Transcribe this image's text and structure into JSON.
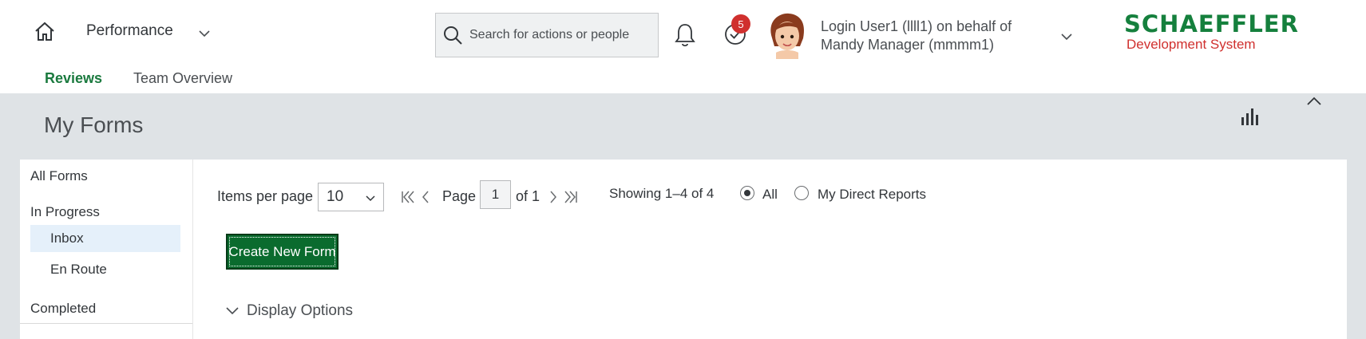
{
  "header": {
    "module": "Performance",
    "search_placeholder": "Search for actions or people",
    "todo_count": "5",
    "user_name": "Login User1 (llll1) on behalf of Mandy Manager (mmmm1)",
    "logo": {
      "line1": "SCHAEFFLER",
      "line2": "Development System"
    },
    "icons": [
      "home-icon",
      "chevron-down-icon",
      "search-icon",
      "bell-icon",
      "todo-check-icon",
      "avatar",
      "chart-icon",
      "collapse-icon"
    ]
  },
  "subnav": {
    "tabs": [
      {
        "label": "Reviews",
        "active": true
      },
      {
        "label": "Team Overview",
        "active": false
      }
    ]
  },
  "page": {
    "title": "My Forms"
  },
  "sidebar": {
    "items": [
      {
        "label": "All Forms"
      },
      {
        "label": "In Progress"
      },
      {
        "label": "Inbox",
        "selected": true
      },
      {
        "label": "En Route"
      },
      {
        "label": "Completed"
      }
    ]
  },
  "toolbar": {
    "items_per_page_label": "Items per page",
    "items_per_page_value": "10",
    "page_label": "Page",
    "page_value": "1",
    "of_label": "of 1",
    "showing": "Showing 1–4 of 4",
    "filter_options": [
      {
        "label": "All",
        "selected": true
      },
      {
        "label": "My Direct Reports",
        "selected": false
      }
    ],
    "create_button": "Create New Form",
    "display_options": "Display Options"
  },
  "colors": {
    "accent": "#1b7a3f",
    "button_bg": "#0a6b2e",
    "badge": "#d0302e",
    "page_bg": "#dfe3e6",
    "selected_bg": "#e5f0fa",
    "logo_green": "#15803d",
    "logo_red": "#d0302e"
  }
}
